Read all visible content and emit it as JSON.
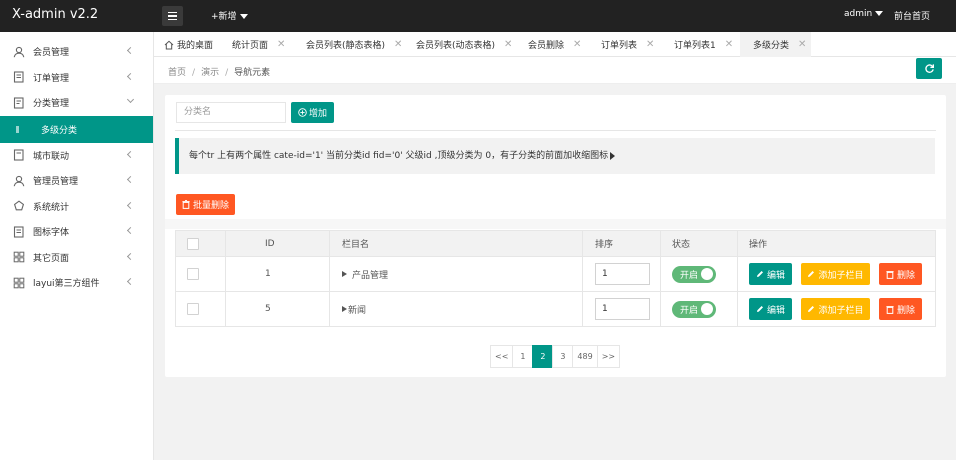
{
  "header": {
    "logo": "X-admin v2.2",
    "add_new": "+新增",
    "admin": "admin",
    "front_home": "前台首页"
  },
  "sidebar": {
    "items": [
      {
        "label": "会员管理",
        "icon": "user-icon"
      },
      {
        "label": "订单管理",
        "icon": "order-icon"
      },
      {
        "label": "分类管理",
        "icon": "category-icon",
        "expanded": true
      },
      {
        "label": "城市联动",
        "icon": "city-icon"
      },
      {
        "label": "管理员管理",
        "icon": "admin-icon"
      },
      {
        "label": "系统统计",
        "icon": "stats-icon"
      },
      {
        "label": "图标字体",
        "icon": "icon-font-icon"
      },
      {
        "label": "其它页面",
        "icon": "pages-icon"
      },
      {
        "label": "layui第三方组件",
        "icon": "grid-icon"
      }
    ],
    "sub_active": "多级分类"
  },
  "tabs": [
    {
      "label": "我的桌面",
      "closable": false
    },
    {
      "label": "统计页面",
      "closable": true
    },
    {
      "label": "会员列表(静态表格)",
      "closable": true
    },
    {
      "label": "会员列表(动态表格)",
      "closable": true
    },
    {
      "label": "会员删除",
      "closable": true
    },
    {
      "label": "订单列表",
      "closable": true
    },
    {
      "label": "订单列表1",
      "closable": true
    },
    {
      "label": "多级分类",
      "closable": true,
      "active": true
    }
  ],
  "tab_close_glyph": "✕",
  "breadcrumb": {
    "items": [
      "首页",
      "演示",
      "导航元素"
    ],
    "separator": "/"
  },
  "search": {
    "placeholder": "分类名",
    "add_label": "增加"
  },
  "notice": "每个tr 上有两个属性 cate-id='1' 当前分类id fid='0' 父级id ,顶级分类为 0，有子分类的前面加收缩图标",
  "batch_delete_label": "批量删除",
  "table": {
    "headers": [
      "ID",
      "栏目名",
      "排序",
      "状态",
      "操作"
    ],
    "rows": [
      {
        "id": "1",
        "name": "产品管理",
        "sort": "1",
        "status": "开启",
        "prefix": "expand"
      },
      {
        "id": "5",
        "name": "新闻",
        "sort": "1",
        "status": "开启",
        "prefix": "expand"
      }
    ],
    "actions": {
      "edit": "编辑",
      "add_sub": "添加子栏目",
      "delete": "删除"
    }
  },
  "pagination": {
    "pages": [
      "<<",
      "1",
      "2",
      "3",
      "489",
      ">>"
    ],
    "current": "2"
  },
  "colors": {
    "primary": "#009688",
    "danger": "#ff5722",
    "warning": "#ffb800",
    "switch_on": "#5fb878",
    "header_bg": "#222222"
  }
}
